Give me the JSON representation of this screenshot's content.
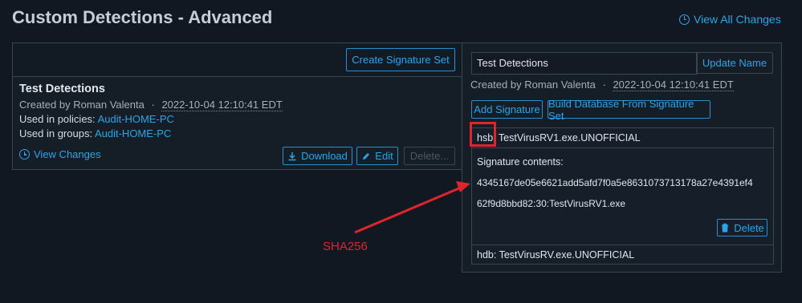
{
  "page_title": "Custom Detections - Advanced",
  "view_all_changes_label": "View All Changes",
  "left_panel": {
    "create_button_label": "Create Signature Set",
    "detection_name": "Test Detections",
    "created_by_prefix": "Created by Roman Valenta",
    "separator": "·",
    "created_at": "2022-10-04 12:10:41 EDT",
    "policies_label": "Used in policies:",
    "policies_value": "Audit-HOME-PC",
    "groups_label": "Used in groups:",
    "groups_value": "Audit-HOME-PC",
    "view_changes_label": "View Changes",
    "download_label": "Download",
    "edit_label": "Edit",
    "delete_label": "Delete..."
  },
  "right_panel": {
    "name_value": "Test Detections",
    "update_name_label": "Update Name",
    "created_by_prefix": "Created by Roman Valenta",
    "separator": "·",
    "created_at": "2022-10-04 12:10:41 EDT",
    "add_signature_label": "Add Signature",
    "build_database_label": "Build Database From Signature Set",
    "signature1": {
      "type": "hsb:",
      "name": "TestVirusRV1.exe.UNOFFICIAL",
      "contents_label": "Signature contents:",
      "contents_line1": "4345167de05e6621add5afd7f0a5e8631073713178a27e4391ef4",
      "contents_line2": "62f9d8bbd82:30:TestVirusRV1.exe",
      "delete_label": "Delete"
    },
    "signature2": {
      "type": "hdb:",
      "name": "TestVirusRV.exe.UNOFFICIAL"
    }
  },
  "annotation": {
    "label": "SHA256",
    "color": "#e0242b"
  },
  "colors": {
    "background": "#111822",
    "accent": "#2ba5e8",
    "border": "#3a4552"
  }
}
